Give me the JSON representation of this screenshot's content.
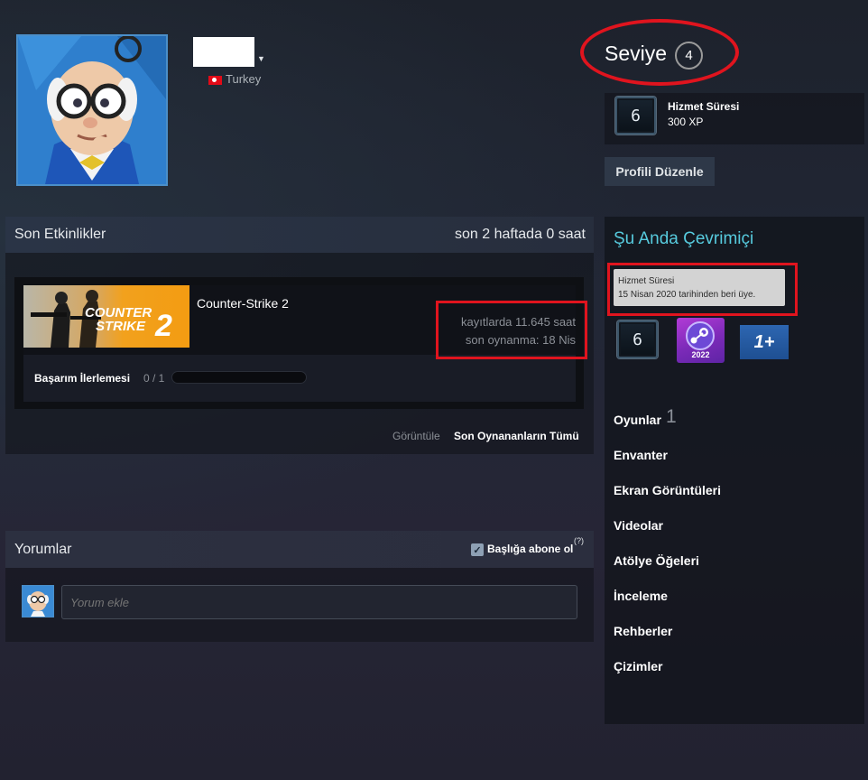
{
  "profile": {
    "country": "Turkey",
    "level_label": "Seviye",
    "level": "4",
    "badge": {
      "years": "6",
      "title": "Hizmet Süresi",
      "xp": "300 XP"
    },
    "edit_button": "Profili Düzenle"
  },
  "recent_activity": {
    "title": "Son Etkinlikler",
    "hours_summary": "son 2 haftada 0 saat",
    "game": {
      "capsule_text_1": "COUNTER",
      "capsule_text_2": "STRIKE",
      "capsule_number": "2",
      "name": "Counter-Strike 2",
      "hours_on_record": "kayıtlarda 11.645 saat",
      "last_played": "son oynanma: 18 Nis",
      "achievements_label": "Başarım İlerlemesi",
      "achievements_count": "0 / 1",
      "achievements_progress": 0
    },
    "view_label": "Görüntüle",
    "view_all": "Son Oynananların Tümü"
  },
  "comments": {
    "title": "Yorumlar",
    "subscribe_label": "Başlığa abone ol",
    "subscribe_checked": true,
    "help": "(?)",
    "input_placeholder": "Yorum ekle"
  },
  "sidebar": {
    "status": "Şu Anda Çevrimiçi",
    "tooltip_title": "Hizmet Süresi",
    "tooltip_text": "15 Nisan 2020 tarihinden beri üye.",
    "badges": {
      "years": "6",
      "steam_year": "2022",
      "oneplus": "1+"
    },
    "games_label": "Oyunlar",
    "games_count": "1",
    "links": [
      "Envanter",
      "Ekran Görüntüleri",
      "Videolar",
      "Atölye Öğeleri",
      "İnceleme",
      "Rehberler",
      "Çizimler"
    ]
  },
  "colors": {
    "online": "#57cbde",
    "highlight": "#e0141e",
    "accent": "#f39c12"
  }
}
